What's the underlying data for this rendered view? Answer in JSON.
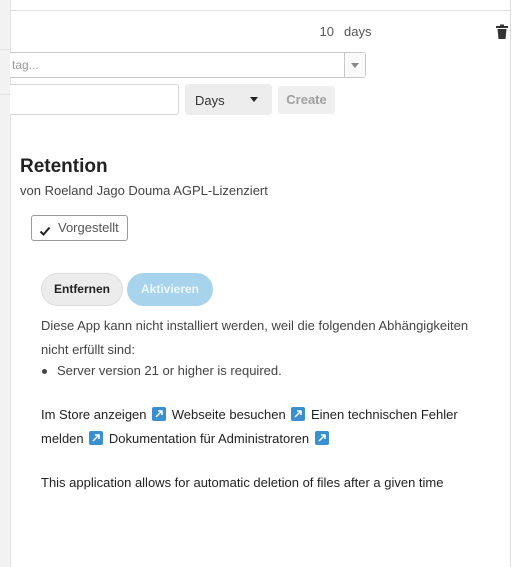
{
  "retention_rule": {
    "days_value": "10",
    "days_unit": "days",
    "tag_placeholder": "tag...",
    "unit_select": "Days",
    "create_label": "Create"
  },
  "app": {
    "title": "Retention",
    "author_line": "von Roeland Jago Douma AGPL-Lizenziert",
    "featured_badge": "Vorgestellt",
    "remove_label": "Entfernen",
    "enable_label": "Aktivieren",
    "dependency_text": "Diese App kann nicht installiert werden, weil die folgenden Abhängigkeiten nicht erfüllt sind:",
    "dependencies": [
      "Server version 21 or higher is required."
    ],
    "links": {
      "store": "Im Store anzeigen",
      "website": "Webseite besuchen",
      "bug": "Einen technischen Fehler melden",
      "docs": "Dokumentation für Administratoren"
    },
    "description": "This application allows for automatic deletion of files after a given time"
  },
  "icons": {
    "trash": "trash-icon",
    "check": "check-icon",
    "external_link": "external-link-icon",
    "dropdown": "chevron-down-icon"
  },
  "colors": {
    "enable_button": "#a7d3ec",
    "external_link_icon": "#3a8fd0"
  }
}
